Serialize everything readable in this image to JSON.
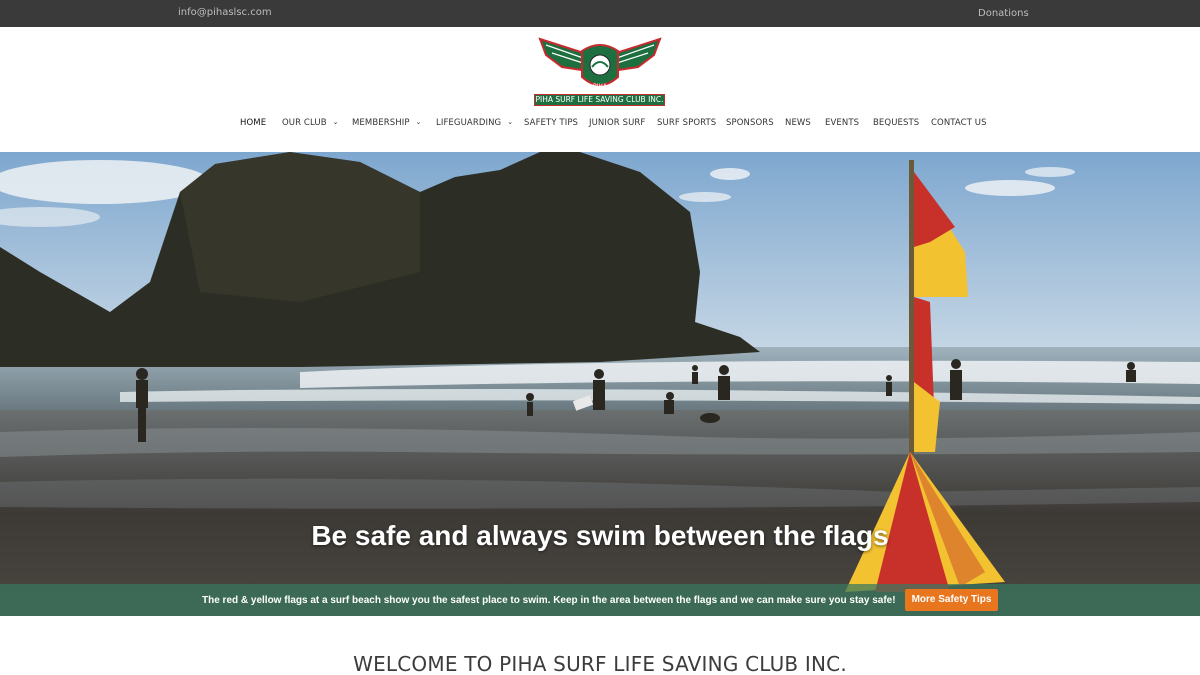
{
  "topbar": {
    "email": "info@pihaslsc.com",
    "donations": "Donations"
  },
  "logo": {
    "emblem_text": "PIHA",
    "banner_text": "PIHA SURF LIFE SAVING CLUB INC.",
    "icon": "winged-emblem-icon"
  },
  "nav": {
    "items": [
      {
        "label": "HOME"
      },
      {
        "label": "OUR CLUB"
      },
      {
        "label": "MEMBERSHIP"
      },
      {
        "label": "LIFEGUARDING"
      },
      {
        "label": "SAFETY TIPS"
      },
      {
        "label": "JUNIOR SURF"
      },
      {
        "label": "SURF SPORTS"
      },
      {
        "label": "SPONSORS"
      },
      {
        "label": "NEWS"
      },
      {
        "label": "EVENTS"
      },
      {
        "label": "BEQUESTS"
      },
      {
        "label": "CONTACT US"
      }
    ],
    "dropdown_icon": "chevron-down-icon"
  },
  "hero": {
    "title": "Be safe and always swim between the flags",
    "strip_text": "The red & yellow flags at a surf beach show you the safest place to swim. Keep in the area between the flags and we can make sure you stay safe!",
    "button_label": "More Safety Tips"
  },
  "welcome": {
    "heading": "WELCOME TO PIHA SURF LIFE SAVING CLUB INC."
  },
  "colors": {
    "topbar": "#3a3a3a",
    "club_green": "#1d6f3f",
    "club_red": "#c8292f",
    "accent_orange": "#e8761e",
    "flag_yellow": "#f2c230",
    "flag_red": "#c8302a"
  }
}
